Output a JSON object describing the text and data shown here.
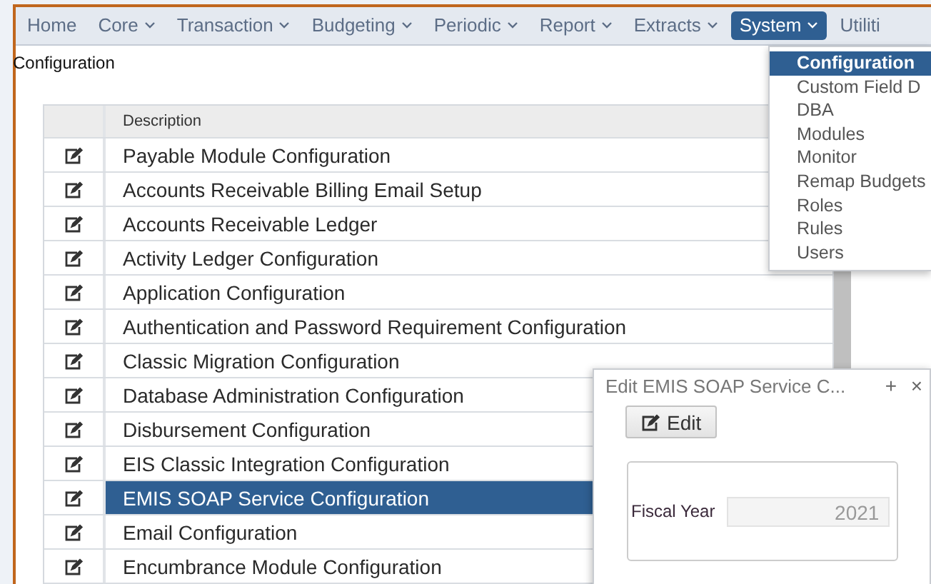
{
  "menu_bar": {
    "items": [
      {
        "label": "Home",
        "dropdown": false,
        "selected": false
      },
      {
        "label": "Core",
        "dropdown": true,
        "selected": false
      },
      {
        "label": "Transaction",
        "dropdown": true,
        "selected": false
      },
      {
        "label": "Budgeting",
        "dropdown": true,
        "selected": false
      },
      {
        "label": "Periodic",
        "dropdown": true,
        "selected": false
      },
      {
        "label": "Report",
        "dropdown": true,
        "selected": false
      },
      {
        "label": "Extracts",
        "dropdown": true,
        "selected": false
      },
      {
        "label": "System",
        "dropdown": true,
        "selected": true
      },
      {
        "label": "Utiliti",
        "dropdown": false,
        "selected": false
      }
    ]
  },
  "breadcrumb": "Configuration",
  "table": {
    "columns": [
      "Description"
    ],
    "rows": [
      {
        "description": "Payable Module Configuration",
        "selected": false
      },
      {
        "description": "Accounts Receivable Billing Email Setup",
        "selected": false
      },
      {
        "description": "Accounts Receivable Ledger",
        "selected": false
      },
      {
        "description": "Activity Ledger Configuration",
        "selected": false
      },
      {
        "description": "Application Configuration",
        "selected": false
      },
      {
        "description": "Authentication and Password Requirement Configuration",
        "selected": false
      },
      {
        "description": "Classic Migration Configuration",
        "selected": false
      },
      {
        "description": "Database Administration Configuration",
        "selected": false
      },
      {
        "description": "Disbursement Configuration",
        "selected": false
      },
      {
        "description": "EIS Classic Integration Configuration",
        "selected": false
      },
      {
        "description": "EMIS SOAP Service Configuration",
        "selected": true
      },
      {
        "description": "Email Configuration",
        "selected": false
      },
      {
        "description": "Encumbrance Module Configuration",
        "selected": false
      }
    ]
  },
  "system_menu": {
    "items": [
      {
        "label": "Configuration",
        "selected": true
      },
      {
        "label": "Custom Field D",
        "selected": false
      },
      {
        "label": "DBA",
        "selected": false
      },
      {
        "label": "Modules",
        "selected": false
      },
      {
        "label": "Monitor",
        "selected": false
      },
      {
        "label": "Remap Budgets",
        "selected": false
      },
      {
        "label": "Roles",
        "selected": false
      },
      {
        "label": "Rules",
        "selected": false
      },
      {
        "label": "Users",
        "selected": false
      }
    ]
  },
  "dialog": {
    "title": "Edit EMIS SOAP Service C...",
    "maximize": "+",
    "close": "×",
    "edit_button": "Edit",
    "fields": [
      {
        "label": "Fiscal Year",
        "value": "2021"
      }
    ]
  }
}
